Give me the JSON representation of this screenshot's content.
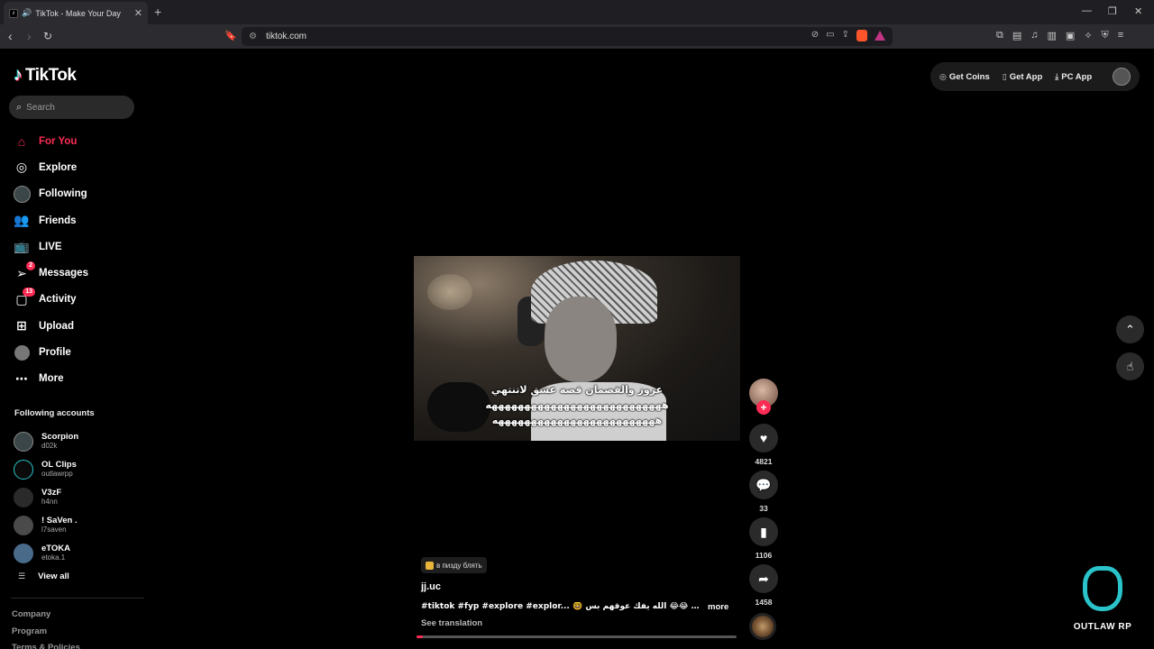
{
  "browser": {
    "tab_title": "TikTok - Make Your Day",
    "url": "tiktok.com"
  },
  "sidebar": {
    "logo_text": "TikTok",
    "search_placeholder": "Search",
    "nav": [
      {
        "label": "For You",
        "icon": "home-icon",
        "active": true
      },
      {
        "label": "Explore",
        "icon": "compass-icon"
      },
      {
        "label": "Following",
        "icon": "following-avatar-icon"
      },
      {
        "label": "Friends",
        "icon": "friends-icon"
      },
      {
        "label": "LIVE",
        "icon": "live-tv-icon"
      },
      {
        "label": "Messages",
        "icon": "paper-plane-icon",
        "badge": "2"
      },
      {
        "label": "Activity",
        "icon": "activity-icon",
        "badge": "13"
      },
      {
        "label": "Upload",
        "icon": "plus-square-icon"
      },
      {
        "label": "Profile",
        "icon": "profile-avatar-icon"
      },
      {
        "label": "More",
        "icon": "more-dots-icon"
      }
    ],
    "following_title": "Following accounts",
    "accounts": [
      {
        "name": "Scorpion",
        "handle": "d02k"
      },
      {
        "name": "OL Clips",
        "handle": "outlawrpp"
      },
      {
        "name": "V3zF",
        "handle": "h4nn"
      },
      {
        "name": "! SaVen .",
        "handle": "l7saven"
      },
      {
        "name": "eTOKA",
        "handle": "etoka.1"
      }
    ],
    "view_all": "View all",
    "footer": [
      "Company",
      "Program",
      "Terms & Policies"
    ]
  },
  "topbar": {
    "get_coins": "Get Coins",
    "get_app": "Get App",
    "pc_app": "PC App"
  },
  "video": {
    "caption_lines": [
      "عزوز والقصمان قصه عشق لاتنتهي",
      "هههههههههههههههههههههههههههه",
      "هههههههههههههههههههههههههه"
    ],
    "likes": "4821",
    "comments": "33",
    "saves": "1106",
    "shares": "1458",
    "tag_chip": "в пизду блять",
    "author": "jj.uc",
    "description": "#tiktok #fyp #explore #explor... 🤓 عزوز واو@ 😂😂 الله يفك عوقهم بس ,",
    "more": "more",
    "see_translation": "See translation",
    "progress": 0.02
  },
  "watermark": {
    "text": "OUTLAW RP"
  }
}
